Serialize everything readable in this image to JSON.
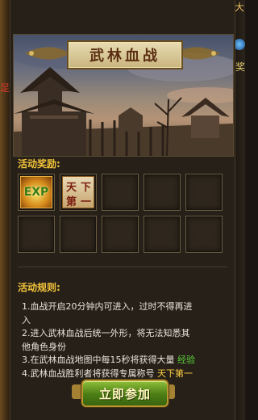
{
  "side_left": {
    "glyph": "足"
  },
  "side_right": {
    "glyph_top": "大",
    "glyph_side": "奖"
  },
  "banner": {
    "title": "武林血战"
  },
  "rewards": {
    "label": "活动奖励:",
    "items": [
      {
        "name": "exp-item",
        "text": "EXP"
      },
      {
        "name": "title-item",
        "chars": [
          "天",
          "下",
          "第",
          "一"
        ]
      }
    ],
    "slot_count": 10
  },
  "rules": {
    "label": "活动规则:",
    "lines": [
      {
        "text": "1.血战开启20分钟内可进入，过时不得再进"
      },
      {
        "text": "入"
      },
      {
        "text": "2.进入武林血战后统一外形，将无法知悉其"
      },
      {
        "text": "他角色身份"
      },
      {
        "text": "3.在武林血战地图中每15秒将获得大量 ",
        "highlight": "经验"
      },
      {
        "text": "4.武林血战胜利者将获得专属称号 ",
        "highlight": "天下第一"
      }
    ]
  },
  "join_button": {
    "label": "立即参加"
  },
  "colors": {
    "label_gold": "#f5c53a",
    "highlight_green": "#5dd03a",
    "highlight_yellow": "#ffd040"
  }
}
